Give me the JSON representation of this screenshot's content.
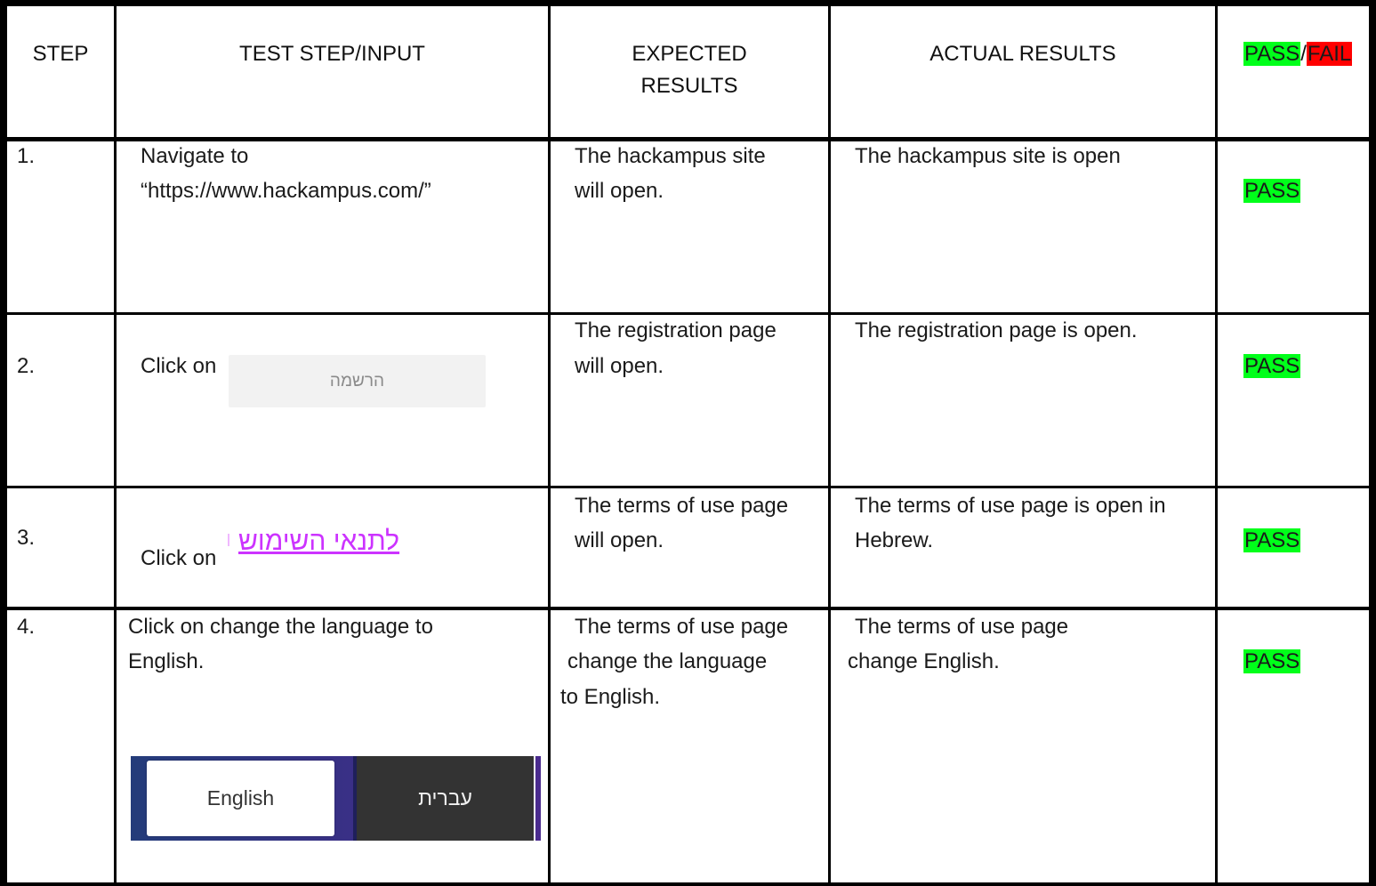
{
  "table": {
    "headers": {
      "step": "STEP",
      "input": "TEST STEP/INPUT",
      "expected_line1": "EXPECTED",
      "expected_line2": "RESULTS",
      "actual": "ACTUAL RESULTS",
      "status_pass": "PASS",
      "status_sep": "/",
      "status_fail": "FAIL"
    },
    "rows": [
      {
        "step": "1.",
        "input_line1": "Navigate to",
        "input_line2": "“https://www.hackampus.com/”",
        "expected_line1": "The hackampus site",
        "expected_line2": "will open.",
        "actual_line1": "The hackampus site is open",
        "status": "PASS"
      },
      {
        "step": "2.",
        "input_prefix": "Click on",
        "input_button": "הרשמה",
        "expected_line1": "The registration page",
        "expected_line2": "will open.",
        "actual_line1": "The registration page is open.",
        "status": "PASS"
      },
      {
        "step": "3.",
        "input_prefix": "Click on",
        "input_link": "לתנאי השימוש",
        "expected_line1": "The terms of use page",
        "expected_line2": "will open.",
        "actual_line1": "The terms of use page is open in",
        "actual_line2": "Hebrew.",
        "status": "PASS"
      },
      {
        "step": "4.",
        "input_line1": "Click on change the language to",
        "input_line2": "English.",
        "input_button_english": "English",
        "input_button_hebrew": "עברית",
        "expected_line1": "The terms of use page",
        "expected_line2": "change the language",
        "expected_line3": "to English.",
        "actual_line1": "The terms of use page",
        "actual_line2": "change English.",
        "status": "PASS"
      }
    ]
  },
  "colors": {
    "pass_highlight": "#00ff1a",
    "fail_highlight": "#ff0000",
    "link_color": "#cc33ff",
    "language_bar": "#3a2f86",
    "hebrew_button": "#333333"
  }
}
